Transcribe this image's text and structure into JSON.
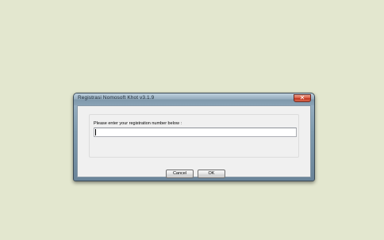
{
  "window": {
    "title": "Registrasi Nomosoft Khot v3.1.9",
    "close_icon": "close-icon"
  },
  "form": {
    "prompt": "Please enter your registration number below :",
    "registration_value": "",
    "registration_placeholder": ""
  },
  "buttons": {
    "cancel_label": "Cancel",
    "ok_label": "OK"
  }
}
